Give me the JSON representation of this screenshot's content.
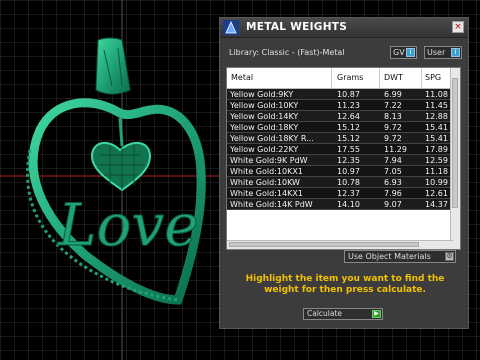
{
  "window": {
    "title": "METAL WEIGHTS",
    "close_label": "×"
  },
  "library": {
    "label": "Library: Classic - (Fast)-Metal",
    "gv_label": "GV",
    "user_label": "User",
    "toggle_mark": "i"
  },
  "table": {
    "columns": [
      "Metal",
      "Grams",
      "DWT",
      "SPG"
    ],
    "rows": [
      {
        "metal": "Yellow Gold:9KY",
        "grams": "10.87",
        "dwt": "6.99",
        "spg": "11.08"
      },
      {
        "metal": "Yellow Gold:10KY",
        "grams": "11.23",
        "dwt": "7.22",
        "spg": "11.45"
      },
      {
        "metal": "Yellow Gold:14KY",
        "grams": "12.64",
        "dwt": "8.13",
        "spg": "12.88"
      },
      {
        "metal": "Yellow Gold:18KY",
        "grams": "15.12",
        "dwt": "9.72",
        "spg": "15.41"
      },
      {
        "metal": "Yellow Gold:18KY R...",
        "grams": "15.12",
        "dwt": "9.72",
        "spg": "15.41"
      },
      {
        "metal": "Yellow Gold:22KY",
        "grams": "17.55",
        "dwt": "11.29",
        "spg": "17.89"
      },
      {
        "metal": "White Gold:9K PdW",
        "grams": "12.35",
        "dwt": "7.94",
        "spg": "12.59"
      },
      {
        "metal": "White Gold:10KX1",
        "grams": "10.97",
        "dwt": "7.05",
        "spg": "11.18"
      },
      {
        "metal": "White Gold:10KW",
        "grams": "10.78",
        "dwt": "6.93",
        "spg": "10.99"
      },
      {
        "metal": "White Gold:14KX1",
        "grams": "12.37",
        "dwt": "7.96",
        "spg": "12.61"
      },
      {
        "metal": "White Gold:14K PdW",
        "grams": "14.10",
        "dwt": "9.07",
        "spg": "14.37"
      }
    ]
  },
  "use_object_materials": {
    "label": "Use Object Materials",
    "icon": "gear-icon",
    "icon_glyph": "⚙"
  },
  "instructions": "Highlight the item you want to find the weight for then press calculate.",
  "calculate": {
    "label": "Calculate",
    "icon": "play-arrow-icon",
    "icon_glyph": "▶"
  },
  "pendant": {
    "text": "Love"
  },
  "colors": {
    "background": "#000000",
    "grid": "#2f2f2f",
    "pendant_green": "#1fa276",
    "panel_bg": "#3c3c3c",
    "accent_text": "#f2c200",
    "axis_red": "#b02020"
  }
}
